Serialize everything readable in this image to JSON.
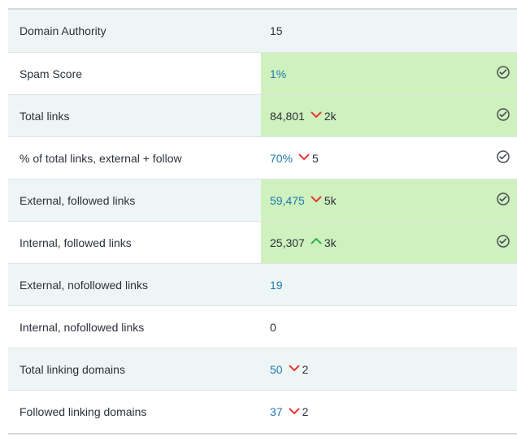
{
  "rows": [
    {
      "label": "Domain Authority",
      "value": "15",
      "value_style": "normal",
      "change": "",
      "change_dir": "",
      "good": false,
      "check": false
    },
    {
      "label": "Spam Score",
      "value": "1%",
      "value_style": "link",
      "change": "",
      "change_dir": "",
      "good": true,
      "check": true
    },
    {
      "label": "Total links",
      "value": "84,801",
      "value_style": "normal",
      "change": "2k",
      "change_dir": "down",
      "good": true,
      "check": true
    },
    {
      "label": "% of total links, external + follow",
      "value": "70%",
      "value_style": "link",
      "change": "5",
      "change_dir": "down",
      "good": false,
      "check": true
    },
    {
      "label": "External, followed links",
      "value": "59,475",
      "value_style": "link",
      "change": "5k",
      "change_dir": "down",
      "good": true,
      "check": true
    },
    {
      "label": "Internal, followed links",
      "value": "25,307",
      "value_style": "normal",
      "change": "3k",
      "change_dir": "up",
      "good": true,
      "check": true
    },
    {
      "label": "External, nofollowed links",
      "value": "19",
      "value_style": "link",
      "change": "",
      "change_dir": "",
      "good": false,
      "check": false
    },
    {
      "label": "Internal, nofollowed links",
      "value": "0",
      "value_style": "normal",
      "change": "",
      "change_dir": "",
      "good": false,
      "check": false
    },
    {
      "label": "Total linking domains",
      "value": "50",
      "value_style": "link",
      "change": "2",
      "change_dir": "down",
      "good": false,
      "check": false
    },
    {
      "label": "Followed linking domains",
      "value": "37",
      "value_style": "link",
      "change": "2",
      "change_dir": "down",
      "good": false,
      "check": false
    }
  ],
  "colors": {
    "shaded_row": "#eef6f5",
    "good_cell": "#cff1bd",
    "link_text": "#1f78b4",
    "down_arrow": "#e53935",
    "up_arrow": "#2fb356",
    "check_icon": "#4a4f55"
  },
  "icons": {
    "down": "chevron-down-icon",
    "up": "chevron-up-icon",
    "check": "check-circle-icon"
  }
}
